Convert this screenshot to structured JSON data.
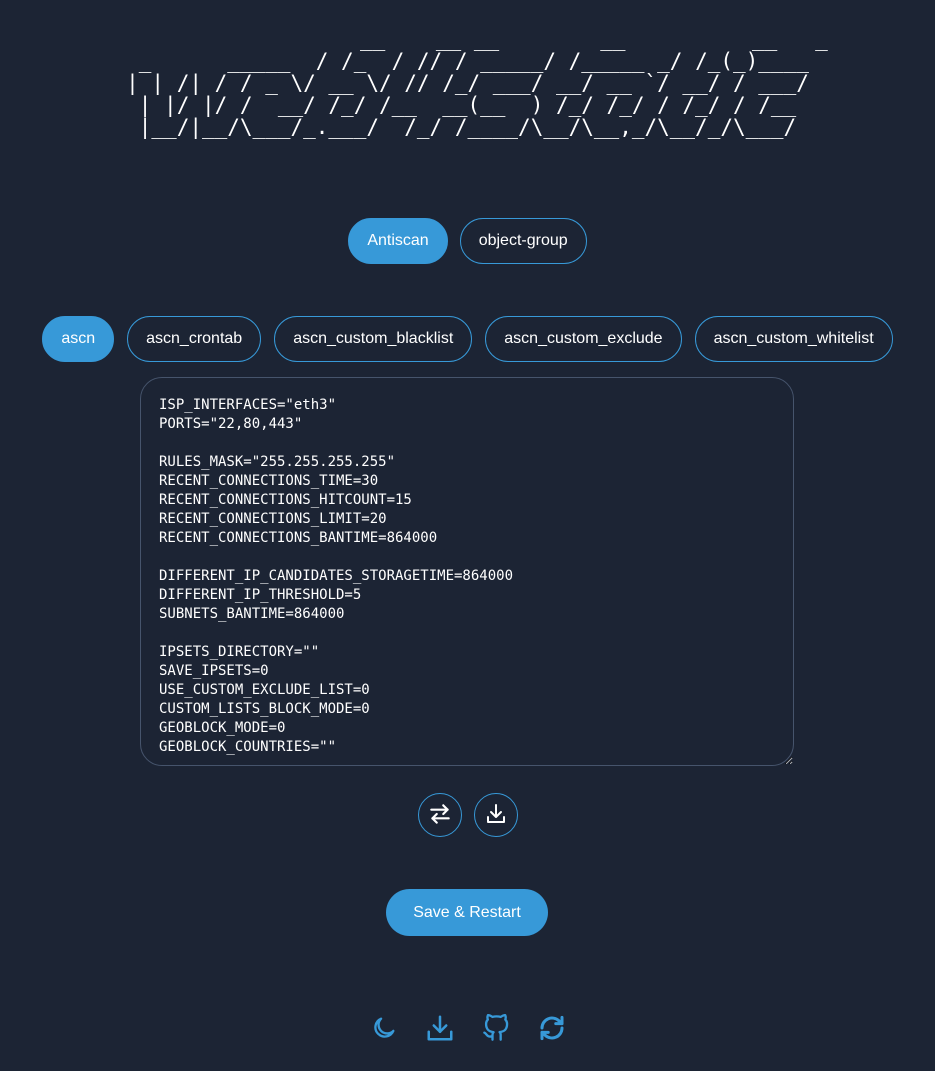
{
  "header": {
    "logo_text": "                    __    __ __        __          __   _\n _      _____  / /_  / // / _____/ /_____ _/ /_(_)____\n| | /| / / _ \\/ __ \\/ // /_/ ___/ __/ __ `/ __/ / ___/\n| |/ |/ /  __/ /_/ /__  __(__  ) /_/ /_/ / /_/ / /__\n|__/|__/\\___/_.___/  /_/ /____/\\__/\\__,_/\\__/_/\\___/"
  },
  "apps": [
    {
      "label": "Antiscan",
      "active": true
    },
    {
      "label": "object-group",
      "active": false
    }
  ],
  "files": [
    {
      "label": "ascn",
      "active": true
    },
    {
      "label": "ascn_crontab",
      "active": false
    },
    {
      "label": "ascn_custom_blacklist",
      "active": false
    },
    {
      "label": "ascn_custom_exclude",
      "active": false
    },
    {
      "label": "ascn_custom_whitelist",
      "active": false
    }
  ],
  "editor": {
    "content": "ISP_INTERFACES=\"eth3\"\nPORTS=\"22,80,443\"\n\nRULES_MASK=\"255.255.255.255\"\nRECENT_CONNECTIONS_TIME=30\nRECENT_CONNECTIONS_HITCOUNT=15\nRECENT_CONNECTIONS_LIMIT=20\nRECENT_CONNECTIONS_BANTIME=864000\n\nDIFFERENT_IP_CANDIDATES_STORAGETIME=864000\nDIFFERENT_IP_THRESHOLD=5\nSUBNETS_BANTIME=864000\n\nIPSETS_DIRECTORY=\"\"\nSAVE_IPSETS=0\nUSE_CUSTOM_EXCLUDE_LIST=0\nCUSTOM_LISTS_BLOCK_MODE=0\nGEOBLOCK_MODE=0\nGEOBLOCK_COUNTRIES=\"\""
  },
  "actions": {
    "icons": [
      "swap-arrows-icon",
      "download-icon"
    ],
    "save_label": "Save & Restart"
  },
  "footer": {
    "icons": [
      "moon-icon",
      "download-icon",
      "github-icon",
      "refresh-icon"
    ]
  },
  "colors": {
    "background": "#1c2434",
    "accent": "#3799d8",
    "text": "#ffffff",
    "editor_border": "#46546c"
  }
}
